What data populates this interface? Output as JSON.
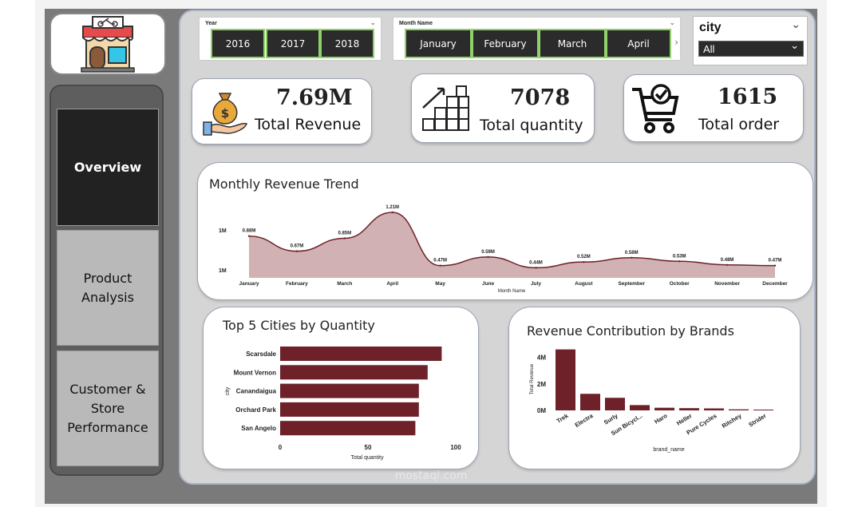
{
  "slicers": {
    "year": {
      "title": "Year",
      "options": [
        "2016",
        "2017",
        "2018"
      ]
    },
    "month": {
      "title": "Month Name",
      "options": [
        "January",
        "February",
        "March",
        "April"
      ]
    },
    "city": {
      "title": "city",
      "selected": "All"
    }
  },
  "nav": {
    "items": [
      {
        "label": "Overview",
        "active": true
      },
      {
        "label": "Product Analysis",
        "active": false
      },
      {
        "label": "Customer & Store Performance",
        "active": false
      }
    ]
  },
  "kpis": {
    "revenue": {
      "value": "7.69M",
      "label": "Total Revenue"
    },
    "quantity": {
      "value": "7078",
      "label": "Total quantity"
    },
    "order": {
      "value": "1615",
      "label": "Total order"
    }
  },
  "colors": {
    "accent": "#6e2128",
    "area": "#c9a3a6",
    "nav_active": "#222222",
    "chip_border": "#8fd16a"
  },
  "chart_data": [
    {
      "type": "area",
      "title": "Monthly Revenue Trend",
      "xlabel": "Month Name",
      "ylabel": "",
      "y_ticks": [
        "1M",
        "1M"
      ],
      "categories": [
        "January",
        "February",
        "March",
        "April",
        "May",
        "June",
        "July",
        "August",
        "September",
        "October",
        "November",
        "December"
      ],
      "values": [
        0.88,
        0.67,
        0.85,
        1.21,
        0.47,
        0.59,
        0.44,
        0.52,
        0.58,
        0.53,
        0.48,
        0.47
      ],
      "labels": [
        "0.88M",
        "0.67M",
        "0.85M",
        "1.21M",
        "0.47M",
        "0.59M",
        "0.44M",
        "0.52M",
        "0.58M",
        "0.53M",
        "0.48M",
        "0.47M"
      ]
    },
    {
      "type": "bar",
      "orientation": "horizontal",
      "title": "Top 5 Cities by Quantity",
      "xlabel": "Total quantity",
      "ylabel": "city",
      "categories": [
        "Scarsdale",
        "Mount Vernon",
        "Canandaigua",
        "Orchard Park",
        "San Angelo"
      ],
      "values": [
        92,
        84,
        79,
        79,
        77
      ],
      "x_ticks": [
        0,
        50,
        100
      ],
      "xlim": [
        0,
        100
      ]
    },
    {
      "type": "bar",
      "title": "Revenue Contribution by Brands",
      "xlabel": "brand_name",
      "ylabel": "Total Revenue",
      "categories": [
        "Trek",
        "Electra",
        "Surly",
        "Sun Bicycl...",
        "Haro",
        "Heller",
        "Pure Cycles",
        "Ritchey",
        "Strider"
      ],
      "values": [
        4.6,
        1.25,
        0.95,
        0.4,
        0.2,
        0.17,
        0.15,
        0.08,
        0.005
      ],
      "y_ticks": [
        "0M",
        "2M",
        "4M"
      ],
      "ylim": [
        0,
        5
      ]
    }
  ],
  "watermark": {
    "arabic": "مستقل",
    "latin": "mostaql.com"
  }
}
